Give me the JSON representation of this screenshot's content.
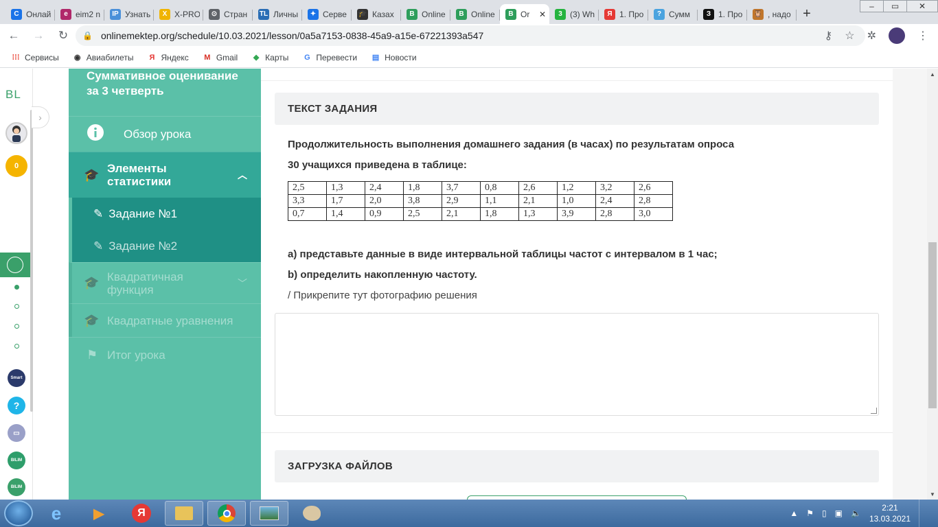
{
  "browser": {
    "tabs": [
      {
        "title": "Онлай",
        "icon": "C",
        "color": "#1a73e8"
      },
      {
        "title": "eim2 n",
        "icon": "e",
        "color": "#b0286a"
      },
      {
        "title": "Узнать",
        "icon": "IP",
        "color": "#4a90d9"
      },
      {
        "title": "X-PRO",
        "icon": "X",
        "color": "#f0b400"
      },
      {
        "title": "Стран",
        "icon": "⊙",
        "color": "#5f6368"
      },
      {
        "title": "Личны",
        "icon": "TL",
        "color": "#2a6db5"
      },
      {
        "title": "Серве",
        "icon": "✦",
        "color": "#1a73e8"
      },
      {
        "title": "Казах",
        "icon": "🎓",
        "color": "#333"
      },
      {
        "title": "Online",
        "icon": "B",
        "color": "#2e9e5b"
      },
      {
        "title": "Online",
        "icon": "B",
        "color": "#2e9e5b"
      },
      {
        "title": "Or",
        "icon": "B",
        "color": "#2e9e5b",
        "active": true
      },
      {
        "title": "(3) Wh",
        "icon": "3",
        "color": "#25b33f"
      },
      {
        "title": "1. Про",
        "icon": "Я",
        "color": "#e53935"
      },
      {
        "title": "Сумм",
        "icon": "?",
        "color": "#4aa3df"
      },
      {
        "title": "1. Про",
        "icon": "З",
        "color": "#111"
      },
      {
        "title": ", надо",
        "icon": "🦉",
        "color": "#c0762c"
      }
    ],
    "url": "onlinemektep.org/schedule/10.03.2021/lesson/0a5a7153-0838-45a9-a15e-67221393a547",
    "bookmarks": [
      {
        "label": "Сервисы",
        "icon": "apps-icon"
      },
      {
        "label": "Авиабилеты",
        "icon": "globe-icon"
      },
      {
        "label": "Яндекс",
        "icon": "yandex-icon"
      },
      {
        "label": "Gmail",
        "icon": "gmail-icon"
      },
      {
        "label": "Карты",
        "icon": "maps-icon"
      },
      {
        "label": "Перевести",
        "icon": "translate-icon"
      },
      {
        "label": "Новости",
        "icon": "news-icon"
      }
    ]
  },
  "leftbar": {
    "logo": "BL",
    "score": "0"
  },
  "sidebar": {
    "title": "Суммативное оценивание за 3 четверть",
    "overview": "Обзор урока",
    "section_active": "Элементы статистики",
    "tasks": [
      "Задание №1",
      "Задание №2"
    ],
    "section_quadratic_fn": "Квадратичная функция",
    "section_quadratic_eq": "Квадратные уравнения",
    "summary": "Итог урока"
  },
  "content": {
    "task_header": "ТЕКСТ ЗАДАНИЯ",
    "line1": "Продолжительность выполнения домашнего задания (в часах) по результатам опроса",
    "line2": "30 учащихся приведена в таблице:",
    "table": [
      [
        "2,5",
        "1,3",
        "2,4",
        "1,8",
        "3,7",
        "0,8",
        "2,6",
        "1,2",
        "3,2",
        "2,6"
      ],
      [
        "3,3",
        "1,7",
        "2,0",
        "3,8",
        "2,9",
        "1,1",
        "2,1",
        "1,0",
        "2,4",
        "2,8"
      ],
      [
        "0,7",
        "1,4",
        "0,9",
        "2,5",
        "2,1",
        "1,8",
        "1,3",
        "3,9",
        "2,8",
        "3,0"
      ]
    ],
    "part_a": "а) представьте данные в виде интервальной таблицы частот с интервалом в 1 час;",
    "part_b": "b) определить накопленную частоту.",
    "attach_hint": "/ Прикрепите тут фотографию решения",
    "upload_header": "ЗАГРУЗКА ФАЙЛОВ"
  },
  "taskbar": {
    "time": "2:21",
    "date": "13.03.2021"
  }
}
